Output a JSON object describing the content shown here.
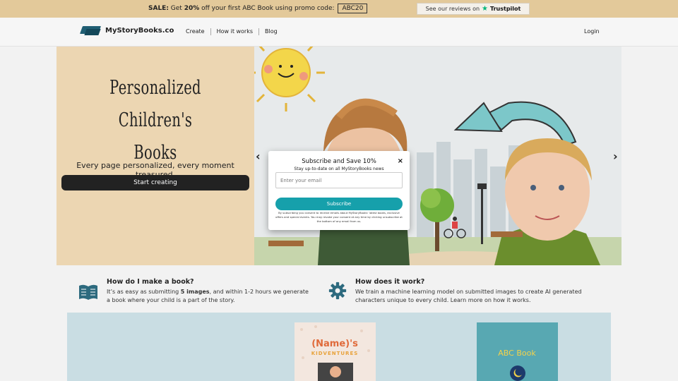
{
  "promo": {
    "sale_label": "SALE:",
    "text_before": " Get ",
    "discount": "20%",
    "text_after": " off your first ABC Book using promo code: ",
    "code": "ABC20",
    "trust_text": "See our reviews on",
    "trust_brand": "Trustpilot"
  },
  "nav": {
    "brand": "MyStoryBooks.co",
    "links": [
      "Create",
      "How it works",
      "Blog"
    ],
    "login": "Login"
  },
  "hero": {
    "title_line1": "Personalized Children's",
    "title_line2": "Books",
    "subtitle": "Every page personalized, every moment treasured.",
    "cta": "Start creating",
    "prev_icon": "chevron-left-icon",
    "next_icon": "chevron-right-icon"
  },
  "modal": {
    "title": "Subscribe and Save 10%",
    "subtitle": "Stay up-to-date on all MyStoryBooks news",
    "email_placeholder": "Enter your email",
    "button": "Subscribe",
    "close": "×",
    "fine_print": "By subscribing you consent to receive emails about MyStoryBooks' latest books, exclusive offers and special events. You may revoke your consent at any time by clicking unsubscribe at the bottom of any email from us."
  },
  "info": [
    {
      "icon": "open-book-icon",
      "title": "How do I make a book?",
      "text_before": "It’s as easy as submitting ",
      "text_bold": "5 images",
      "text_after": ", and within 1-2 hours we generate a book where your child is a part of the story."
    },
    {
      "icon": "gear-icon",
      "title": "How does it work?",
      "text": "We train a machine learning model on submitted images to create AI generated characters unique to every child. Learn more on how it works."
    }
  ],
  "books": [
    {
      "title_line1": "(Name)'s",
      "title_line2": "KIDVENTURES"
    },
    {
      "title": "ABC Book"
    }
  ],
  "colors": {
    "promo_bg": "#e3c99a",
    "hero_left_bg": "#ecd6b2",
    "accent": "#16a0ab",
    "brand": "#1f5e73"
  }
}
